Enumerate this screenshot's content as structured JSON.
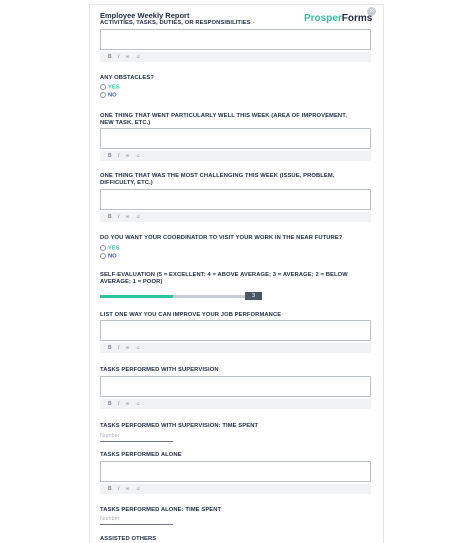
{
  "form": {
    "title": "Employee Weekly Report",
    "brand_part1": "Prosper",
    "brand_part2": "Forms",
    "close_symbol": "×",
    "accent_color": "#2ec4a0"
  },
  "toolbar": {
    "bold": "B",
    "italic": "I",
    "link": "∞",
    "emoji": "☺"
  },
  "questions": {
    "activities": {
      "label": "ACTIVITIES, TASKS, DUTIES, OR RESPONSIBILITIES",
      "required": "•"
    },
    "obstacles": {
      "label": "ANY OBSTACLES?",
      "yes": "YES",
      "no": "NO"
    },
    "went_well": {
      "label": "ONE THING THAT WENT PARTICULARLY WELL THIS WEEK (AREA OF IMPROVEMENT, NEW TASK, ETC.)"
    },
    "challenging": {
      "label": "ONE THING THAT WAS THE MOST CHALLENGING THIS WEEK (ISSUE, PROBLEM, DIFFICULTY, ETC.)"
    },
    "coordinator": {
      "label": "DO YOU WANT YOUR COORDINATOR TO VISIT YOUR WORK IN THE NEAR FUTURE?",
      "yes": "YES",
      "no": "NO"
    },
    "self_eval": {
      "label": "SELF-EVALUATION (5 = EXCELLENT; 4 = ABOVE AVERAGE; 3 = AVERAGE; 2 = BELOW AVERAGE; 1 = POOR)",
      "value": "3",
      "min": 1,
      "max": 5,
      "fill_fraction": 0.5
    },
    "improve": {
      "label": "LIST ONE WAY YOU CAN IMPROVE YOUR JOB PERFORMANCE"
    },
    "supervised": {
      "label": "TASKS PERFORMED WITH SUPERVISION"
    },
    "supervised_time": {
      "label": "TASKS PERFORMED WITH SUPERVISION: TIME SPENT",
      "placeholder": "Number"
    },
    "alone": {
      "label": "TASKS PERFORMED ALONE"
    },
    "alone_time": {
      "label": "TASKS PERFORMED ALONE: TIME SPENT",
      "placeholder": "Number"
    },
    "assisted": {
      "label": "ASSISTED OTHERS"
    }
  }
}
